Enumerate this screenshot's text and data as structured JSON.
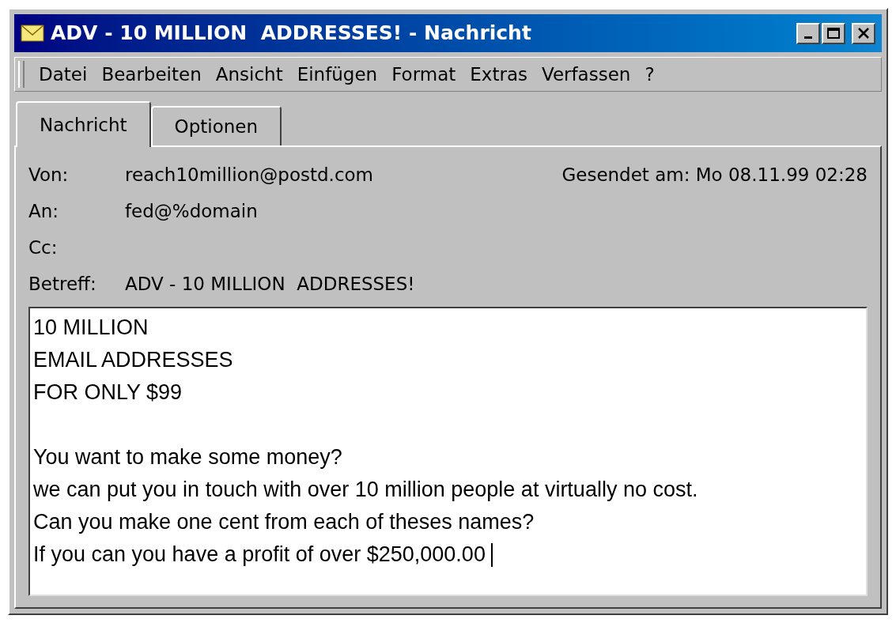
{
  "window": {
    "title": "ADV - 10 MILLION  ADDRESSES! - Nachricht"
  },
  "menu": [
    "Datei",
    "Bearbeiten",
    "Ansicht",
    "Einfügen",
    "Format",
    "Extras",
    "Verfassen",
    "?"
  ],
  "tabs": [
    {
      "label": "Nachricht",
      "selected": true
    },
    {
      "label": "Optionen",
      "selected": false
    }
  ],
  "header": {
    "fields": [
      {
        "label": "Von:",
        "value": "reach10million@postd.com"
      },
      {
        "label": "An:",
        "value": "fed@%domain"
      },
      {
        "label": "Cc:"
      },
      {
        "label": "Betreff:",
        "value": "ADV - 10 MILLION  ADDRESSES!"
      }
    ],
    "sent": "Gesendet am: Mo 08.11.99 02:28"
  },
  "body": {
    "paragraphs": [
      [
        "10 MILLION",
        "EMAIL ADDRESSES",
        "FOR ONLY $99"
      ],
      [
        "You want to make some money?",
        "we can put you in touch with over 10 million people at virtually no cost.",
        "Can you make one cent from each of theses names?",
        "If you can you have a profit of over $250,000.00 "
      ]
    ]
  }
}
